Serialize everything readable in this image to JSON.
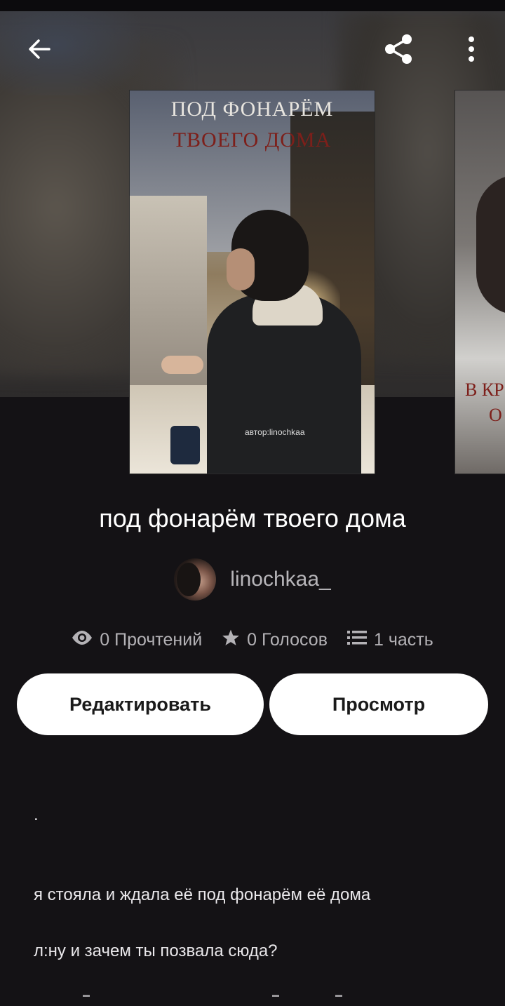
{
  "header": {
    "back_icon": "arrow-left-icon",
    "share_icon": "share-icon",
    "more_icon": "more-vertical-icon"
  },
  "cover": {
    "title_line1": "ПОД ФОНАРЁМ",
    "title_line2": "ТВОЕГО ДОМА",
    "author_caption": "автор:linochkaa"
  },
  "next_cover": {
    "title_line1": "В КР",
    "title_line2": "О"
  },
  "story": {
    "title": "под фонарём твоего дома",
    "author": "linochkaa_"
  },
  "stats": {
    "reads": "0 Прочтений",
    "votes": "0 Голосов",
    "parts": "1 часть"
  },
  "actions": {
    "edit_label": "Редактировать",
    "view_label": "Просмотр"
  },
  "description": {
    "lines": [
      ".",
      "я стояла и ждала её под фонарём её дома",
      "л:ну и зачем ты позвала сюда?"
    ]
  },
  "colors": {
    "background": "#141215",
    "button_bg": "#ffffff",
    "muted_text": "#b4b2b6",
    "cover_title_red": "#7d1f1a"
  }
}
